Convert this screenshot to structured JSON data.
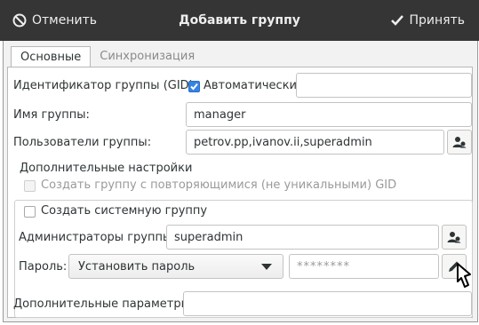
{
  "header": {
    "cancel_label": "Отменить",
    "title": "Добавить группу",
    "accept_label": "Принять"
  },
  "tabs": [
    {
      "label": "Основные",
      "active": true
    },
    {
      "label": "Синхронизация",
      "active": false
    }
  ],
  "form": {
    "gid_label": "Идентификатор группы (GID):",
    "gid_auto_label": "Автоматически",
    "gid_auto_checked": true,
    "gid_value": "",
    "name_label": "Имя группы:",
    "name_value": "manager",
    "users_label": "Пользователи группы:",
    "users_value": "petrov.pp,ivanov.ii,superadmin",
    "advanced": {
      "legend": "Дополнительные настройки",
      "nonunique_label": "Создать группу с повторяющимися (не уникальными) GID",
      "nonunique_checked": false,
      "nonunique_enabled": false,
      "system_label": "Создать системную группу",
      "system_checked": false,
      "admins_label": "Администраторы группы:",
      "admins_value": "superadmin",
      "password_label": "Пароль:",
      "password_option": "Установить пароль",
      "password_value": "********"
    },
    "extra_label": "Дополнительные параметры:",
    "extra_value": ""
  },
  "colors": {
    "titlebar": "#353535",
    "accent": "#3584e4"
  },
  "icons": {
    "cancel": "cancel-circle-icon",
    "accept": "checkmark-icon",
    "users_picker": "user-group-icon",
    "admins_picker": "user-group-icon",
    "password_edit": "pencil-icon",
    "dropdown": "chevron-down-icon"
  }
}
